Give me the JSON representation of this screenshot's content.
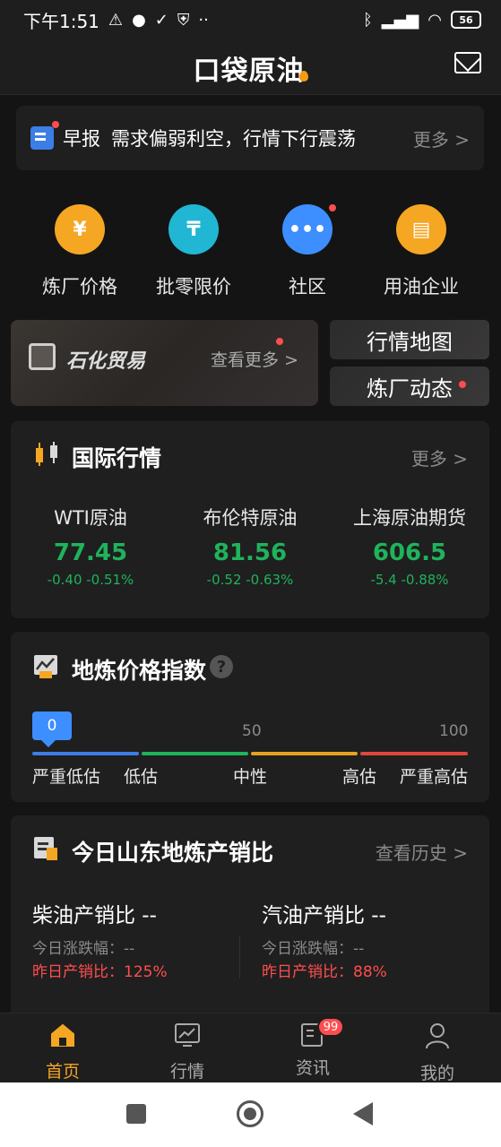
{
  "status": {
    "time": "下午1:51",
    "battery": "56"
  },
  "header": {
    "logo": "口袋原油"
  },
  "brief": {
    "tag": "早报",
    "text": "需求偏弱利空，行情下行震荡",
    "more": "更多 >"
  },
  "quick": [
    {
      "label": "炼厂价格",
      "glyph": "¥",
      "color": "#f5a623"
    },
    {
      "label": "批零限价",
      "glyph": "₸",
      "color": "#21b6d3"
    },
    {
      "label": "社区",
      "glyph": "•••",
      "color": "#3d8eff"
    },
    {
      "label": "用油企业",
      "glyph": "▤",
      "color": "#f5a623"
    }
  ],
  "banner": {
    "title": "石化贸易",
    "more": "查看更多 >",
    "map": "行情地图",
    "dynamics": "炼厂动态"
  },
  "intl": {
    "title": "国际行情",
    "more": "更多 >",
    "items": [
      {
        "name": "WTI原油",
        "price": "77.45",
        "change": "-0.40  -0.51%"
      },
      {
        "name": "布伦特原油",
        "price": "81.56",
        "change": "-0.52  -0.63%"
      },
      {
        "name": "上海原油期货",
        "price": "606.5",
        "change": "-5.4  -0.88%"
      }
    ]
  },
  "index": {
    "title": "地炼价格指数",
    "help": "?",
    "value": "0",
    "mid": "50",
    "max": "100",
    "labels": [
      "严重低估",
      "低估",
      "中性",
      "高估",
      "严重高估"
    ],
    "colors": [
      "#3d7de6",
      "#1fb35b",
      "#e6a11f",
      "#e0463c"
    ]
  },
  "shandong": {
    "title": "今日山东地炼产销比",
    "more": "查看历史 >",
    "diesel": {
      "name": "柴油产销比  --",
      "chg": "今日涨跌幅：--",
      "yday": "昨日产销比：125%"
    },
    "gasoline": {
      "name": "汽油产销比  --",
      "chg": "今日涨跌幅：--",
      "yday": "昨日产销比：88%"
    }
  },
  "tabs": [
    {
      "label": "首页",
      "active": true
    },
    {
      "label": "行情"
    },
    {
      "label": "资讯",
      "badge": "99"
    },
    {
      "label": "我的"
    }
  ]
}
